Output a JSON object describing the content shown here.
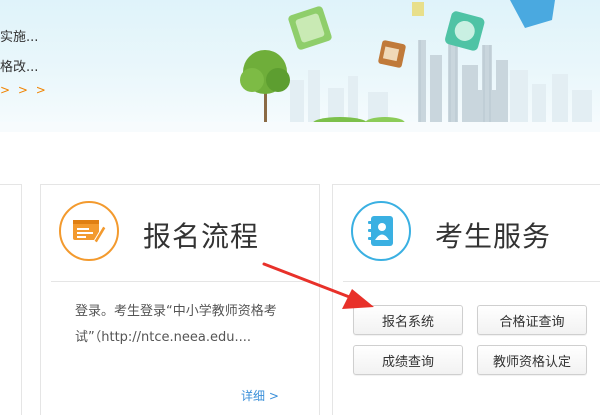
{
  "banner": {
    "news_items": [
      "实施...",
      "格改..."
    ],
    "more_label": "> > >"
  },
  "cards": {
    "registration_flow": {
      "title": "报名流程",
      "text": "登录。考生登录“中小学教师资格考试”（http://ntce.neea.edu....",
      "detail_link": "详细 >",
      "icon": "form-pen-icon",
      "accent_color": "#f39a2e"
    },
    "candidate_services": {
      "title": "考生服务",
      "icon": "address-book-icon",
      "accent_color": "#3ab0e2",
      "buttons": {
        "registration_system": "报名系统",
        "certificate_query": "合格证查询",
        "score_query": "成绩查询",
        "teacher_cert": "教师资格认定"
      }
    }
  },
  "annotation": {
    "arrow_color": "#e8312a"
  }
}
